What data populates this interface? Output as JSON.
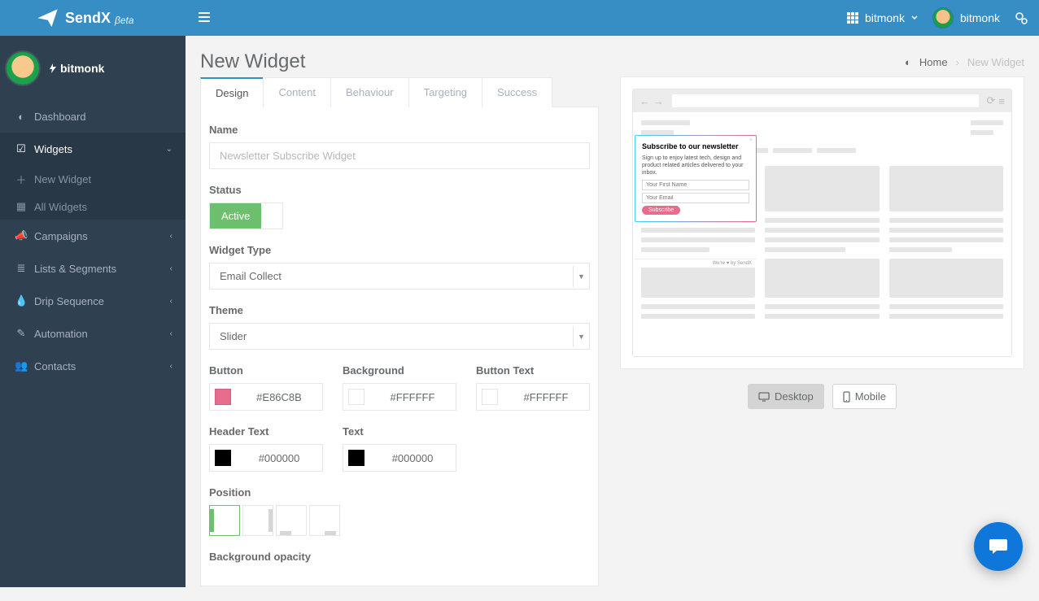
{
  "brand": {
    "name": "SendX",
    "beta": "βeta"
  },
  "topbar": {
    "team": "bitmonk",
    "user": "bitmonk"
  },
  "profile": {
    "name": "bitmonk"
  },
  "sidebar": {
    "items": [
      {
        "label": "Dashboard"
      },
      {
        "label": "Widgets",
        "sub": [
          {
            "label": "New Widget"
          },
          {
            "label": "All Widgets"
          }
        ]
      },
      {
        "label": "Campaigns"
      },
      {
        "label": "Lists & Segments"
      },
      {
        "label": "Drip Sequence"
      },
      {
        "label": "Automation"
      },
      {
        "label": "Contacts"
      }
    ]
  },
  "page": {
    "title": "New Widget"
  },
  "breadcrumb": {
    "home": "Home",
    "current": "New Widget"
  },
  "tabs": [
    {
      "label": "Design"
    },
    {
      "label": "Content"
    },
    {
      "label": "Behaviour"
    },
    {
      "label": "Targeting"
    },
    {
      "label": "Success"
    }
  ],
  "form": {
    "name_label": "Name",
    "name_placeholder": "Newsletter Subscribe Widget",
    "status_label": "Status",
    "status_value": "Active",
    "widget_type_label": "Widget Type",
    "widget_type_value": "Email Collect",
    "theme_label": "Theme",
    "theme_value": "Slider",
    "button_color_label": "Button",
    "button_color": "#E86C8B",
    "background_color_label": "Background",
    "background_color": "#FFFFFF",
    "button_text_color_label": "Button Text",
    "button_text_color": "#FFFFFF",
    "header_text_color_label": "Header Text",
    "header_text_color": "#000000",
    "text_color_label": "Text",
    "text_color": "#000000",
    "position_label": "Position",
    "bg_opacity_label": "Background opacity"
  },
  "preview": {
    "popup_title": "Subscribe to our newsletter",
    "popup_body": "Sign up to enjoy latest tech, design and product related articles delivered to your inbox.",
    "popup_firstname": "Your First Name",
    "popup_email": "Your Email",
    "popup_button": "Subscribe",
    "footer": "We're ♥ by SendX"
  },
  "device": {
    "desktop": "Desktop",
    "mobile": "Mobile"
  }
}
